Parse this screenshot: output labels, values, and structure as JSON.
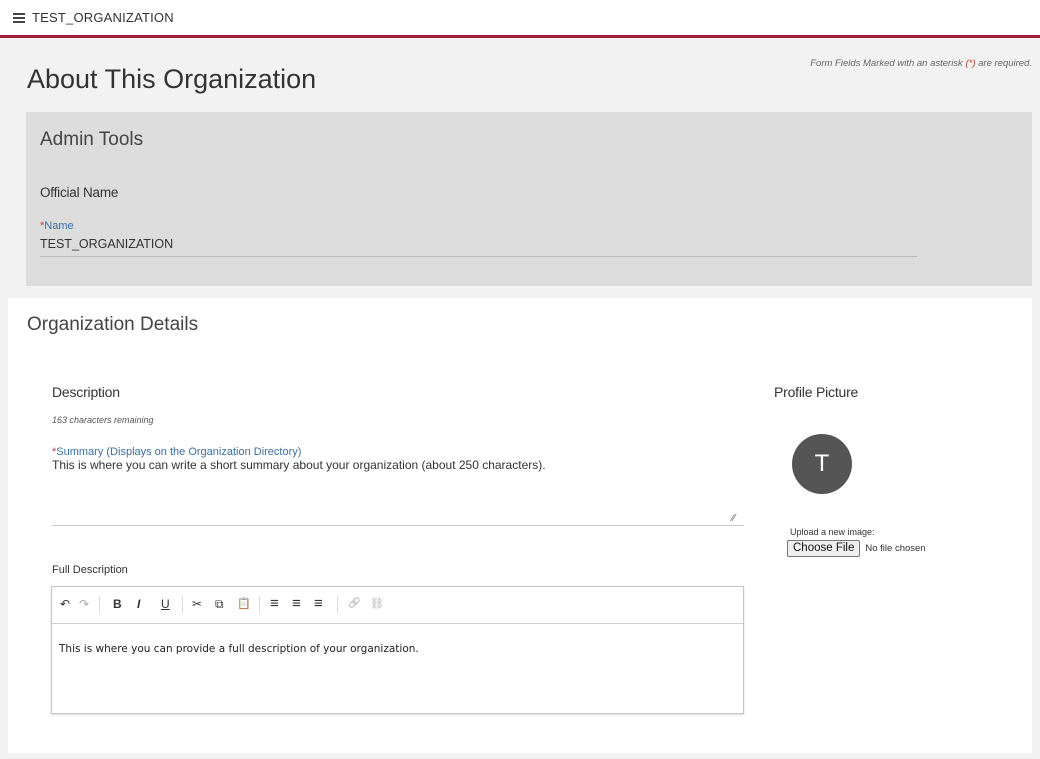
{
  "header": {
    "org_name": "TEST_ORGANIZATION"
  },
  "page": {
    "title": "About This Organization",
    "required_note_prefix": "Form Fields Marked with an asterisk ",
    "required_note_mark": "(*)",
    "required_note_suffix": " are required."
  },
  "admin_tools": {
    "title": "Admin Tools",
    "official_name_heading": "Official Name",
    "name_label": "Name",
    "name_value": "TEST_ORGANIZATION"
  },
  "org_details": {
    "title": "Organization Details",
    "description_heading": "Description",
    "chars_remaining": "163 characters remaining",
    "summary_label": "Summary (Displays on the Organization Directory)",
    "summary_value": "This is where you can write a short summary about your organization (about 250 characters).",
    "full_description_label": "Full Description",
    "full_description_value": "This is where you can provide a full description of your organization.",
    "toolbar": {
      "undo": "↶",
      "redo": "↷",
      "bold": "B",
      "italic": "I",
      "underline": "U",
      "cut": "✂",
      "copy": "⧉",
      "paste": "📋",
      "align_left": "≡",
      "align_center": "≡",
      "align_right": "≡",
      "link": "🔗",
      "unlink": "⛓"
    }
  },
  "profile": {
    "heading": "Profile Picture",
    "avatar_letter": "T",
    "upload_label": "Upload a new image:",
    "choose_file_label": "Choose File",
    "file_status": "No file chosen"
  },
  "colors": {
    "accent": "#9d1c38",
    "label_blue": "#3b6fa0",
    "required_red": "#c0392b"
  }
}
